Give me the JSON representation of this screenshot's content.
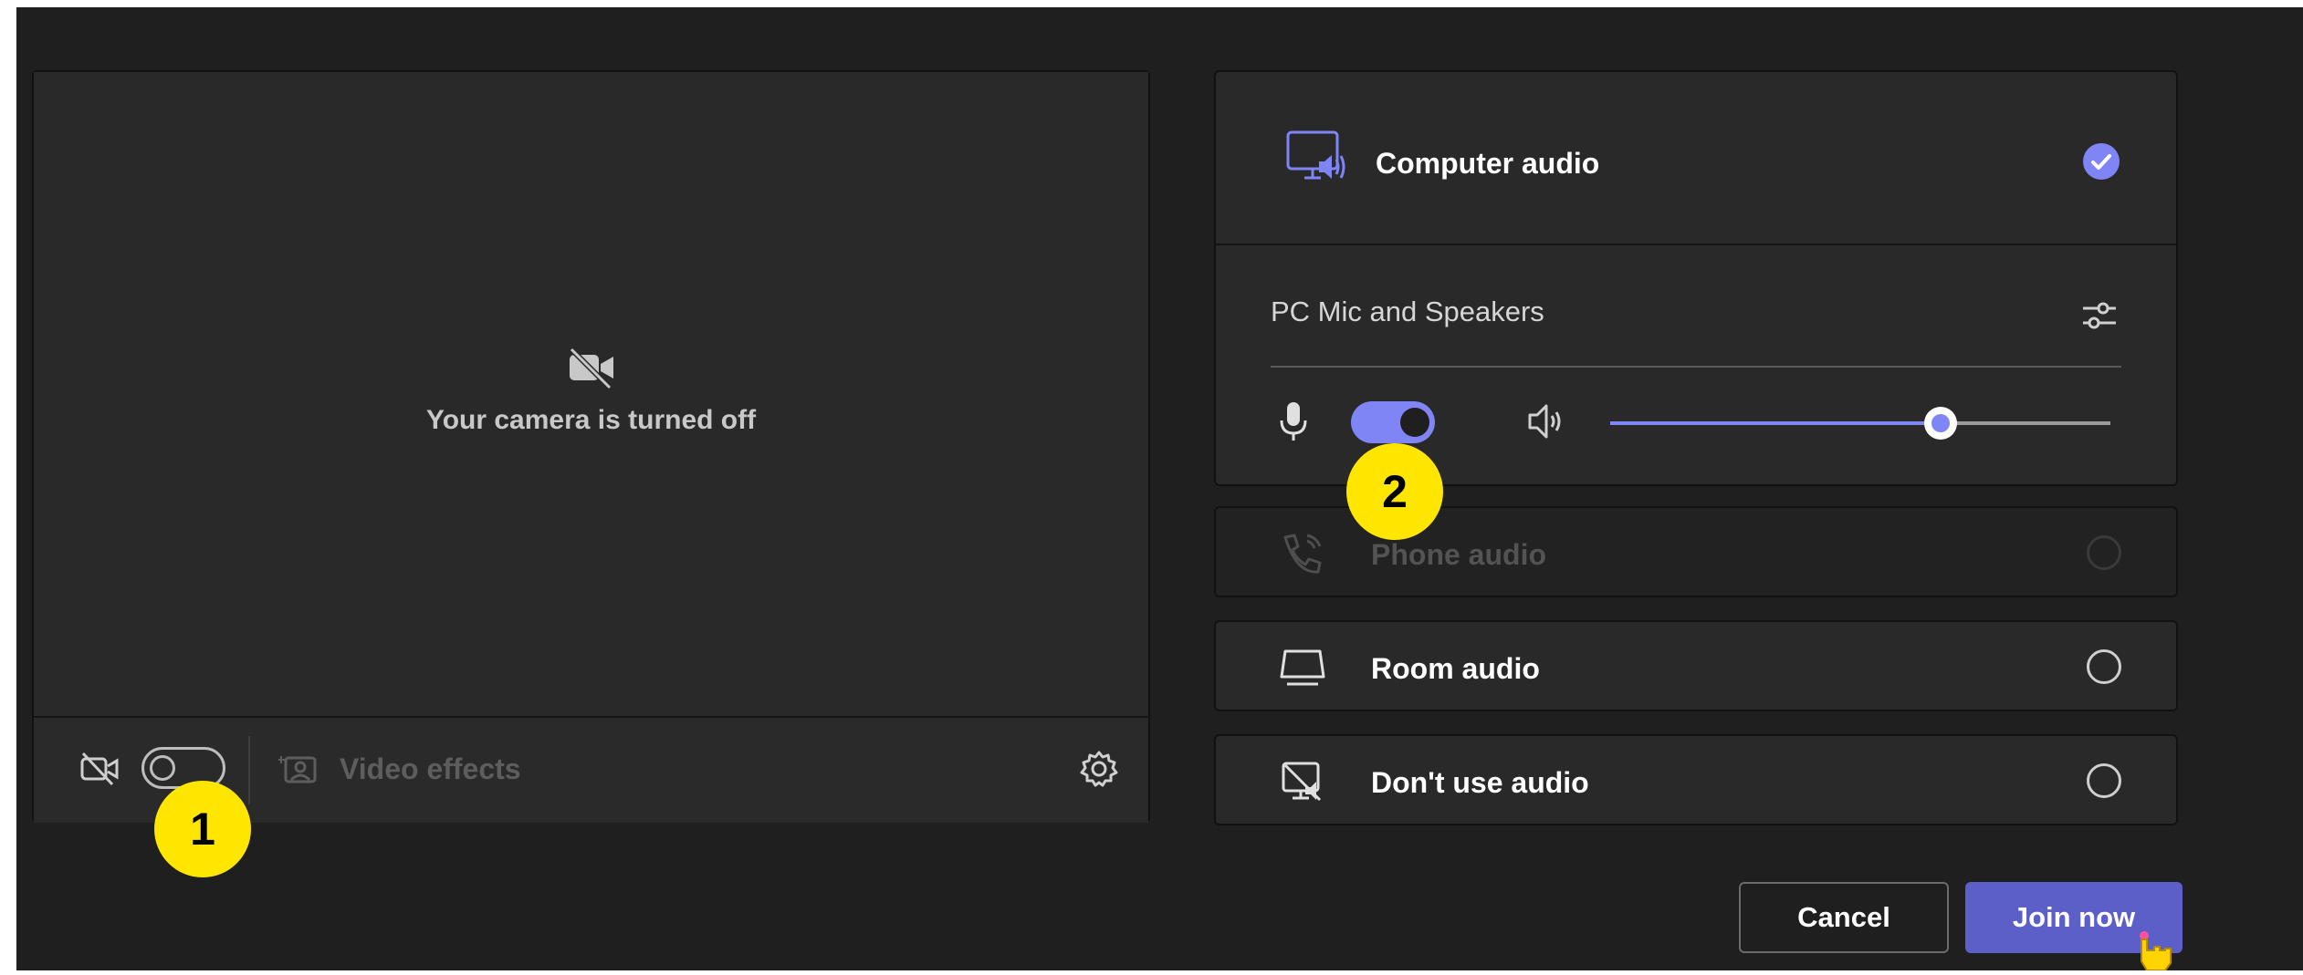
{
  "video": {
    "camera_off_text": "Your camera is turned off",
    "effects_label": "Video effects"
  },
  "audio": {
    "computer_audio_label": "Computer audio",
    "device_name": "PC Mic and Speakers",
    "volume_level": 0.66,
    "options": [
      {
        "label": "Phone audio",
        "disabled": true
      },
      {
        "label": "Room audio",
        "disabled": false
      },
      {
        "label": "Don't use audio",
        "disabled": false
      }
    ]
  },
  "buttons": {
    "cancel_label": "Cancel",
    "join_label": "Join now"
  },
  "callouts": {
    "one": "1",
    "two": "2"
  },
  "colors": {
    "accent": "#7f85f5",
    "primary_button": "#5b5fc7",
    "callout": "#ffe600",
    "background": "#1f1f1f",
    "panel": "#292929"
  },
  "icons": {
    "camera_off": "video-off-icon",
    "effects": "video-effects-icon",
    "settings": "gear-icon",
    "computer_audio": "monitor-speaker-icon",
    "check": "check-circle-icon",
    "device_settings": "sliders-icon",
    "mic": "microphone-icon",
    "speaker": "speaker-icon",
    "phone": "phone-icon",
    "room": "room-icon",
    "no_audio": "no-audio-icon",
    "cursor": "hand-pointer-icon"
  }
}
